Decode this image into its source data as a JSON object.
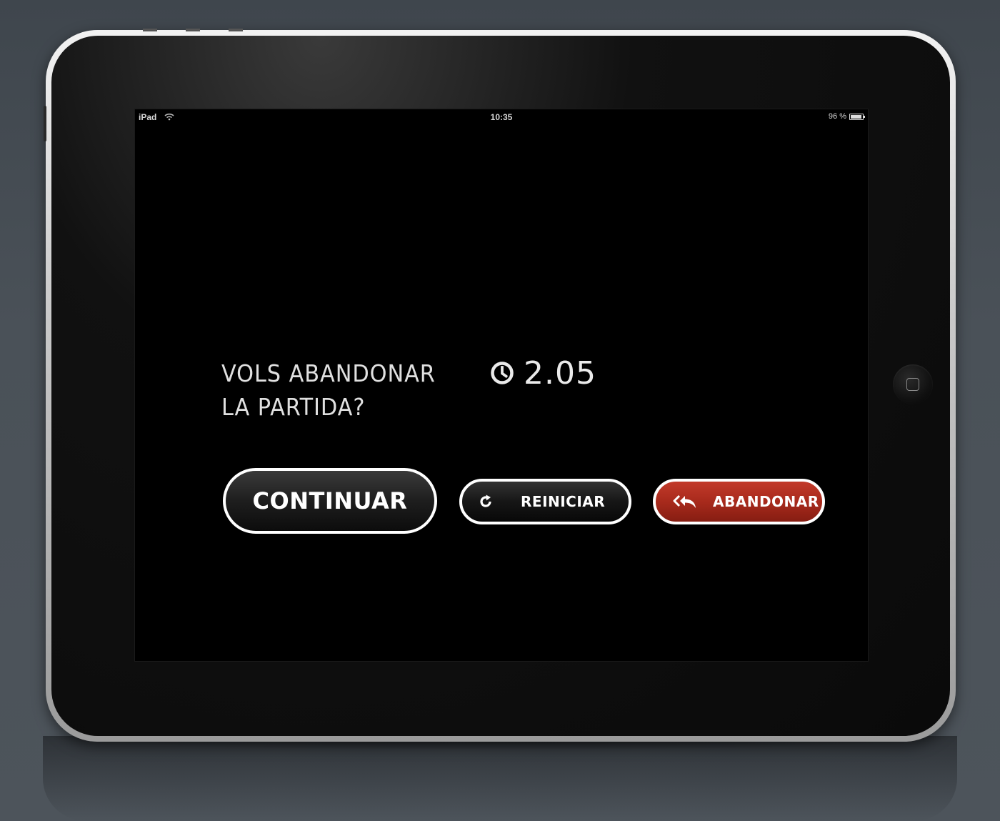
{
  "statusbar": {
    "carrier": "iPad",
    "time": "10:35",
    "battery_text": "96 %",
    "battery_level": 0.96
  },
  "dialog": {
    "question_line1": "VOLS ABANDONAR",
    "question_line2": "LA PARTIDA?",
    "timer_value": "2.05"
  },
  "buttons": {
    "continue_label": "CONTINUAR",
    "restart_label": "REINICIAR",
    "abandon_label": "ABANDONAR"
  },
  "icons": {
    "wifi": "wifi-icon",
    "battery": "battery-icon",
    "timer": "clock-icon",
    "restart": "refresh-icon",
    "abandon": "reply-all-icon",
    "home": "home-button-icon"
  },
  "colors": {
    "background": "#000000",
    "text": "#e0e0e0",
    "button_dark": "#1e1e1e",
    "button_red": "#a82a1c",
    "button_border": "#ffffff"
  }
}
